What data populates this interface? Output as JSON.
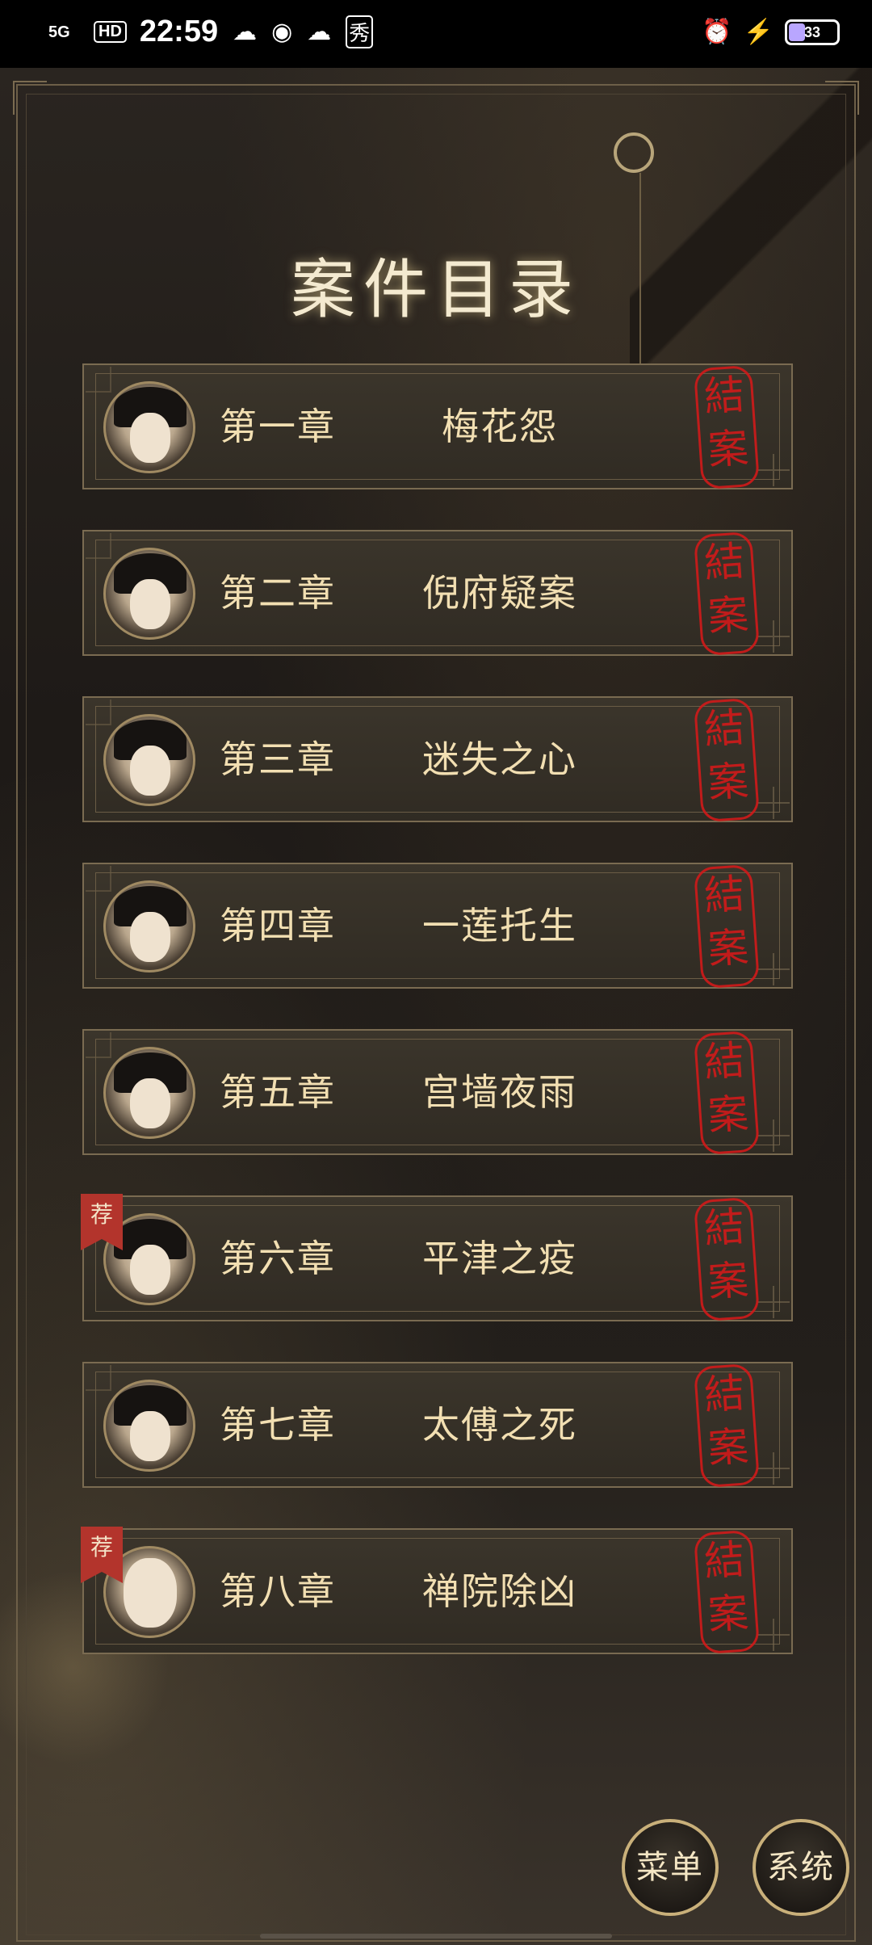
{
  "status_bar": {
    "network": "5G",
    "hd": "HD",
    "time": "22:59",
    "app_icons": [
      "cloud-icon",
      "weibo-icon",
      "cloud-icon",
      "xiu-icon"
    ],
    "xiu_glyph": "秀",
    "battery": "33"
  },
  "title": "案件目录",
  "chapters": [
    {
      "number": "第一章",
      "name": "梅花怨",
      "stamp": "結案",
      "badge": ""
    },
    {
      "number": "第二章",
      "name": "倪府疑案",
      "stamp": "結案",
      "badge": ""
    },
    {
      "number": "第三章",
      "name": "迷失之心",
      "stamp": "結案",
      "badge": ""
    },
    {
      "number": "第四章",
      "name": "一莲托生",
      "stamp": "結案",
      "badge": ""
    },
    {
      "number": "第五章",
      "name": "宫墙夜雨",
      "stamp": "結案",
      "badge": ""
    },
    {
      "number": "第六章",
      "name": "平津之疫",
      "stamp": "結案",
      "badge": "荐"
    },
    {
      "number": "第七章",
      "name": "太傅之死",
      "stamp": "結案",
      "badge": ""
    },
    {
      "number": "第八章",
      "name": "禅院除凶",
      "stamp": "結案",
      "badge": "荐"
    }
  ],
  "buttons": {
    "menu": "菜单",
    "system": "系统"
  }
}
